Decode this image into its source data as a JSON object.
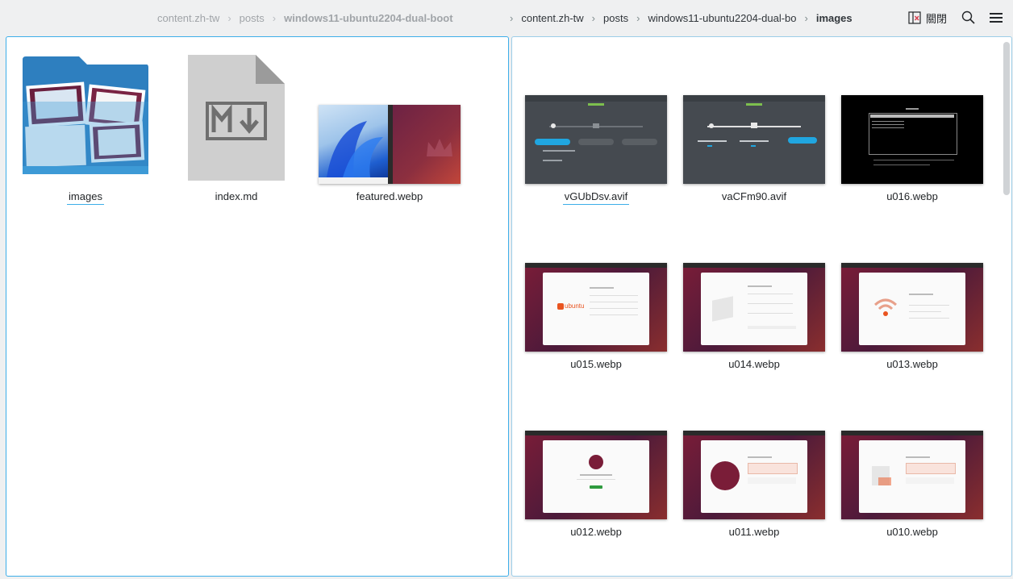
{
  "left_breadcrumb": {
    "items": [
      "content.zh-tw",
      "posts",
      "windows11-ubuntu2204-dual-boot"
    ]
  },
  "right_breadcrumb": {
    "items": [
      "content.zh-tw",
      "posts",
      "windows11-ubuntu2204-dual-bo",
      "images"
    ]
  },
  "toolbar": {
    "close_label": "關閉"
  },
  "left_pane": {
    "files": [
      {
        "name": "images",
        "icon": "folder-icon"
      },
      {
        "name": "index.md",
        "icon": "markdown-file-icon"
      },
      {
        "name": "featured.webp",
        "icon": "image-thumbnail"
      }
    ]
  },
  "right_pane": {
    "files": [
      {
        "name": "vGUbDsv.avif"
      },
      {
        "name": "vaCFm90.avif"
      },
      {
        "name": "u016.webp"
      },
      {
        "name": "u015.webp"
      },
      {
        "name": "u014.webp"
      },
      {
        "name": "u013.webp"
      },
      {
        "name": "u012.webp"
      },
      {
        "name": "u011.webp"
      },
      {
        "name": "u010.webp"
      }
    ]
  },
  "thumb_text": {
    "ubuntu_logo": "ubuntu"
  },
  "colors": {
    "accent": "#3daee9",
    "folder": "#3d9ad6",
    "ubuntu_purple": "#5e2750",
    "ubuntu_orange": "#e95420"
  }
}
